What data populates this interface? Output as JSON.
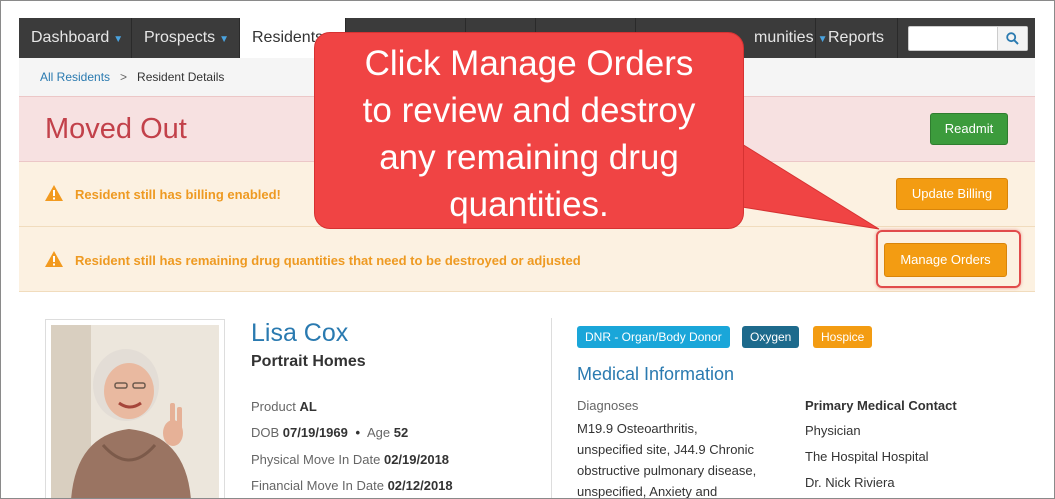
{
  "nav": {
    "items": [
      {
        "label": "Dashboard",
        "caret": true
      },
      {
        "label": "Prospects",
        "caret": true
      },
      {
        "label": "Residents",
        "caret": false,
        "active": true
      },
      {
        "label": "",
        "caret": false
      },
      {
        "label": "",
        "caret": false
      },
      {
        "label": "",
        "caret": false
      },
      {
        "label": "munities",
        "caret": true
      },
      {
        "label": "Reports",
        "caret": false
      }
    ],
    "search_placeholder": ""
  },
  "breadcrumb": {
    "home": "All Residents",
    "separator": ">",
    "current": "Resident Details"
  },
  "status": {
    "title": "Moved Out",
    "readmit_label": "Readmit",
    "billing_warning": "Resident still has billing enabled!",
    "update_billing_label": "Update Billing",
    "drug_warning": "Resident still has remaining drug quantities that need to be destroyed or adjusted",
    "manage_orders_label": "Manage Orders"
  },
  "resident": {
    "name": "Lisa Cox",
    "community": "Portrait Homes",
    "product_label": "Product",
    "product_value": "AL",
    "dob_label": "DOB",
    "dob_value": "07/19/1969",
    "bullet": "•",
    "age_label": "Age",
    "age_value": "52",
    "physical_move_label": "Physical Move In Date",
    "physical_move_value": "02/19/2018",
    "financial_move_label": "Financial Move In Date",
    "financial_move_value": "02/12/2018"
  },
  "tags": [
    {
      "label": "DNR - Organ/Body Donor",
      "color": "#1aa6d9"
    },
    {
      "label": "Oxygen",
      "color": "#1d6a8c"
    },
    {
      "label": "Hospice",
      "color": "#f39c12"
    }
  ],
  "medical": {
    "title": "Medical Information",
    "diagnoses_label": "Diagnoses",
    "diagnoses_lines": [
      "M19.9 Osteoarthritis,",
      "unspecified site, J44.9 Chronic",
      "obstructive pulmonary disease,",
      "unspecified, Anxiety and"
    ],
    "contact_title": "Primary Medical Contact",
    "contact_lines": [
      "Physician",
      "The Hospital Hospital",
      "Dr. Nick Riviera"
    ]
  },
  "callout": {
    "lines": [
      "Click Manage Orders",
      "to review and destroy",
      "any remaining drug",
      "quantities."
    ],
    "color": "#f04444"
  },
  "colors": {
    "accent": "#2a7ab0",
    "danger_text": "#c2414a",
    "warning_text": "#ee9a22",
    "success": "#3c9b3c",
    "warning": "#f39c12"
  }
}
